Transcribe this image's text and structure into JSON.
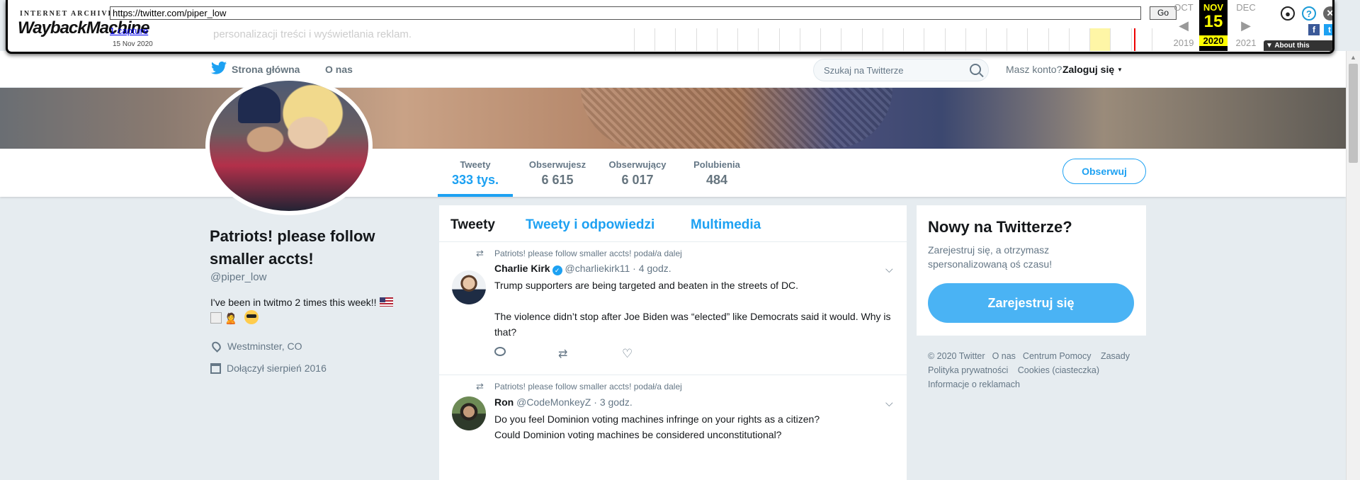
{
  "wayback": {
    "logo_top": "INTERNET ARCHIVE",
    "logo_main": "Wayback",
    "logo_sub": "Machine",
    "url": "https://twitter.com/piper_low",
    "go_label": "Go",
    "captures_label": "1 capture",
    "capture_date": "15 Nov 2020",
    "prev_month": "OCT",
    "cur_month": "NOV",
    "next_month": "DEC",
    "cur_day": "15",
    "prev_year": "2019",
    "cur_year": "2020",
    "next_year": "2021",
    "about_label": "About this capture",
    "ghost_text": "personalizacji treści i wyświetlania reklam."
  },
  "nav": {
    "home": "Strona główna",
    "about": "O nas",
    "search_placeholder": "Szukaj na Twitterze",
    "account_q": "Masz konto?",
    "login": "Zaloguj się"
  },
  "stats": [
    {
      "label": "Tweety",
      "value": "333 tys."
    },
    {
      "label": "Obserwujesz",
      "value": "6 615"
    },
    {
      "label": "Obserwujący",
      "value": "6 017"
    },
    {
      "label": "Polubienia",
      "value": "484"
    }
  ],
  "follow_label": "Obserwuj",
  "profile": {
    "name": "Patriots! please follow smaller accts!",
    "handle": "@piper_low",
    "bio": "I've been in twitmo 2 times this week!!",
    "location": "Westminster, CO",
    "joined": "Dołączył sierpień 2016"
  },
  "tabs": [
    "Tweety",
    "Tweety i odpowiedzi",
    "Multimedia"
  ],
  "tweets": [
    {
      "context": "Patriots! please follow smaller accts! podał/a dalej",
      "name": "Charlie Kirk",
      "handle": "@charliekirk11",
      "time": "· 4 godz.",
      "text": "Trump supporters are being targeted and beaten in the streets of DC.\n\nThe violence didn’t stop after Joe Biden was “elected” like Democrats said it would. Why is that?"
    },
    {
      "context": "Patriots! please follow smaller accts! podał/a dalej",
      "name": "Ron",
      "handle": "@CodeMonkeyZ",
      "time": "· 3 godz.",
      "text": "Do you feel Dominion voting machines infringe on your rights as a citizen?\nCould Dominion voting machines be considered unconstitutional?"
    }
  ],
  "signup": {
    "title": "Nowy na Twitterze?",
    "desc": "Zarejestruj się, a otrzymasz spersonalizowaną oś czasu!",
    "button": "Zarejestruj się"
  },
  "footer": [
    "© 2020 Twitter",
    "O nas",
    "Centrum Pomocy",
    "Zasady",
    "Polityka prywatności",
    "Cookies (ciasteczka)",
    "Informacje o reklamach"
  ],
  "colors": {
    "accent": "#1da1f2",
    "background": "#e6ecf0",
    "wayback_red": "#cc0000"
  }
}
